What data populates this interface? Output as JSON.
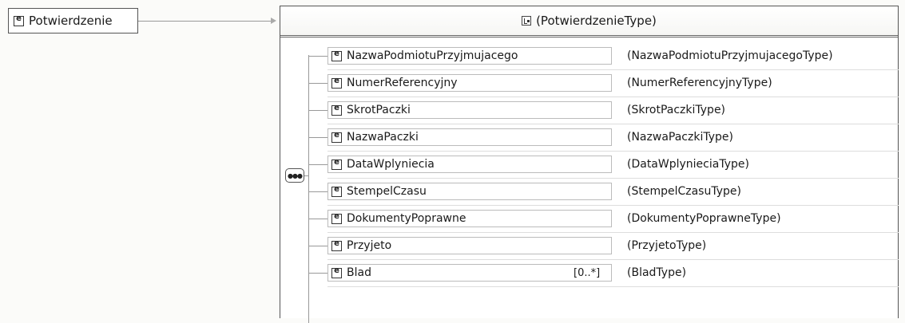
{
  "root_element": {
    "label": "Potwierdzenie",
    "icon": "element-icon"
  },
  "complex_type": {
    "label": "(PotwierdzenieType)",
    "icon": "complex-type-icon"
  },
  "sequence": {
    "icon": "sequence-icon",
    "glyph": "●●●"
  },
  "children": [
    {
      "name": "NazwaPodmiotuPrzyjmujacego",
      "type": "(NazwaPodmiotuPrzyjmujacegoType)",
      "occurs": ""
    },
    {
      "name": "NumerReferencyjny",
      "type": "(NumerReferencyjnyType)",
      "occurs": ""
    },
    {
      "name": "SkrotPaczki",
      "type": "(SkrotPaczkiType)",
      "occurs": ""
    },
    {
      "name": "NazwaPaczki",
      "type": "(NazwaPaczkiType)",
      "occurs": ""
    },
    {
      "name": "DataWplyniecia",
      "type": "(DataWplynieciaType)",
      "occurs": ""
    },
    {
      "name": "StempelCzasu",
      "type": "(StempelCzasuType)",
      "occurs": ""
    },
    {
      "name": "DokumentyPoprawne",
      "type": "(DokumentyPoprawneType)",
      "occurs": ""
    },
    {
      "name": "Przyjeto",
      "type": "(PrzyjetoType)",
      "occurs": ""
    },
    {
      "name": "Blad",
      "type": "(BladType)",
      "occurs": "[0..*]"
    }
  ]
}
